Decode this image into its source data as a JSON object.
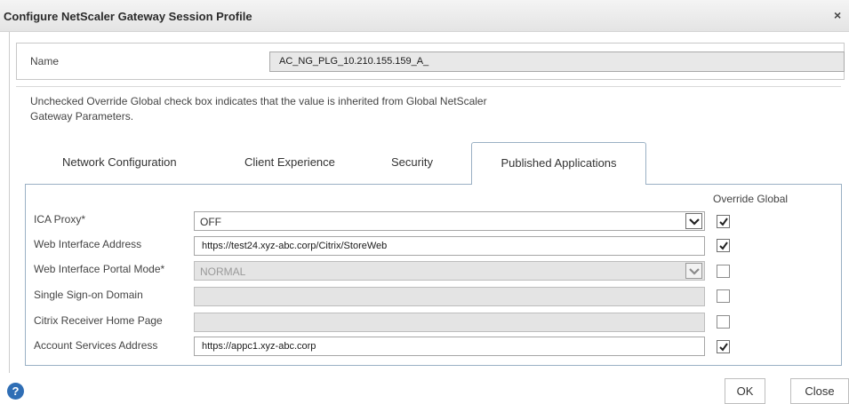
{
  "dialog": {
    "title": "Configure NetScaler Gateway Session Profile",
    "close_glyph": "×"
  },
  "name_field": {
    "label": "Name",
    "value": "AC_NG_PLG_10.210.155.159_A_"
  },
  "info_text": "Unchecked Override Global check box indicates that the value is inherited from Global NetScaler Gateway Parameters.",
  "tabs": [
    {
      "label": "Network Configuration",
      "active": false
    },
    {
      "label": "Client Experience",
      "active": false
    },
    {
      "label": "Security",
      "active": false
    },
    {
      "label": "Published Applications",
      "active": true
    }
  ],
  "panel": {
    "override_header": "Override Global",
    "rows": [
      {
        "label": "ICA Proxy*",
        "type": "select",
        "value": "OFF",
        "enabled": true,
        "override": true
      },
      {
        "label": "Web Interface Address",
        "type": "text",
        "value": "https://test24.xyz-abc.corp/Citrix/StoreWeb",
        "enabled": true,
        "override": true
      },
      {
        "label": "Web Interface Portal Mode*",
        "type": "select",
        "value": "NORMAL",
        "enabled": false,
        "override": false
      },
      {
        "label": "Single Sign-on Domain",
        "type": "text",
        "value": "",
        "enabled": false,
        "override": false
      },
      {
        "label": "Citrix Receiver Home Page",
        "type": "text",
        "value": "",
        "enabled": false,
        "override": false
      },
      {
        "label": "Account Services Address",
        "type": "text",
        "value": "https://appc1.xyz-abc.corp",
        "enabled": true,
        "override": true
      }
    ]
  },
  "footer": {
    "help_icon": "question-mark-icon",
    "help_glyph": "?",
    "ok_label": "OK",
    "close_label": "Close"
  },
  "colors": {
    "tab_border": "#9ab0c4",
    "disabled_field": "#e4e4e4",
    "help_blue": "#2f6eb5"
  }
}
